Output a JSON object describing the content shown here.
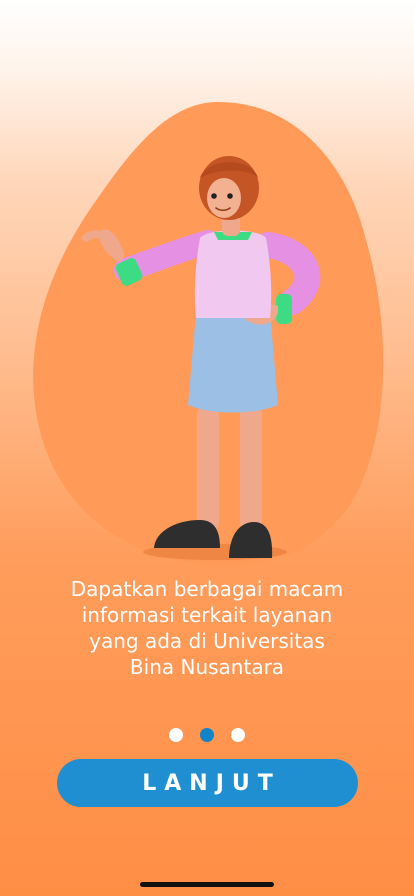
{
  "onboarding": {
    "description": "Dapatkan berbagai macam\ninformasi terkait layanan\nyang ada di Universitas\nBina Nusantara",
    "page_indicator": {
      "total": 3,
      "active_index": 1
    },
    "continue_button_label": "LANJUT"
  },
  "colors": {
    "blob": "#ff9a58",
    "button": "#1f8fd1",
    "dot_active": "#1183c7",
    "dot_inactive": "#ffffff",
    "text": "#ffffff"
  },
  "illustration": "woman-presenting-3d-character"
}
